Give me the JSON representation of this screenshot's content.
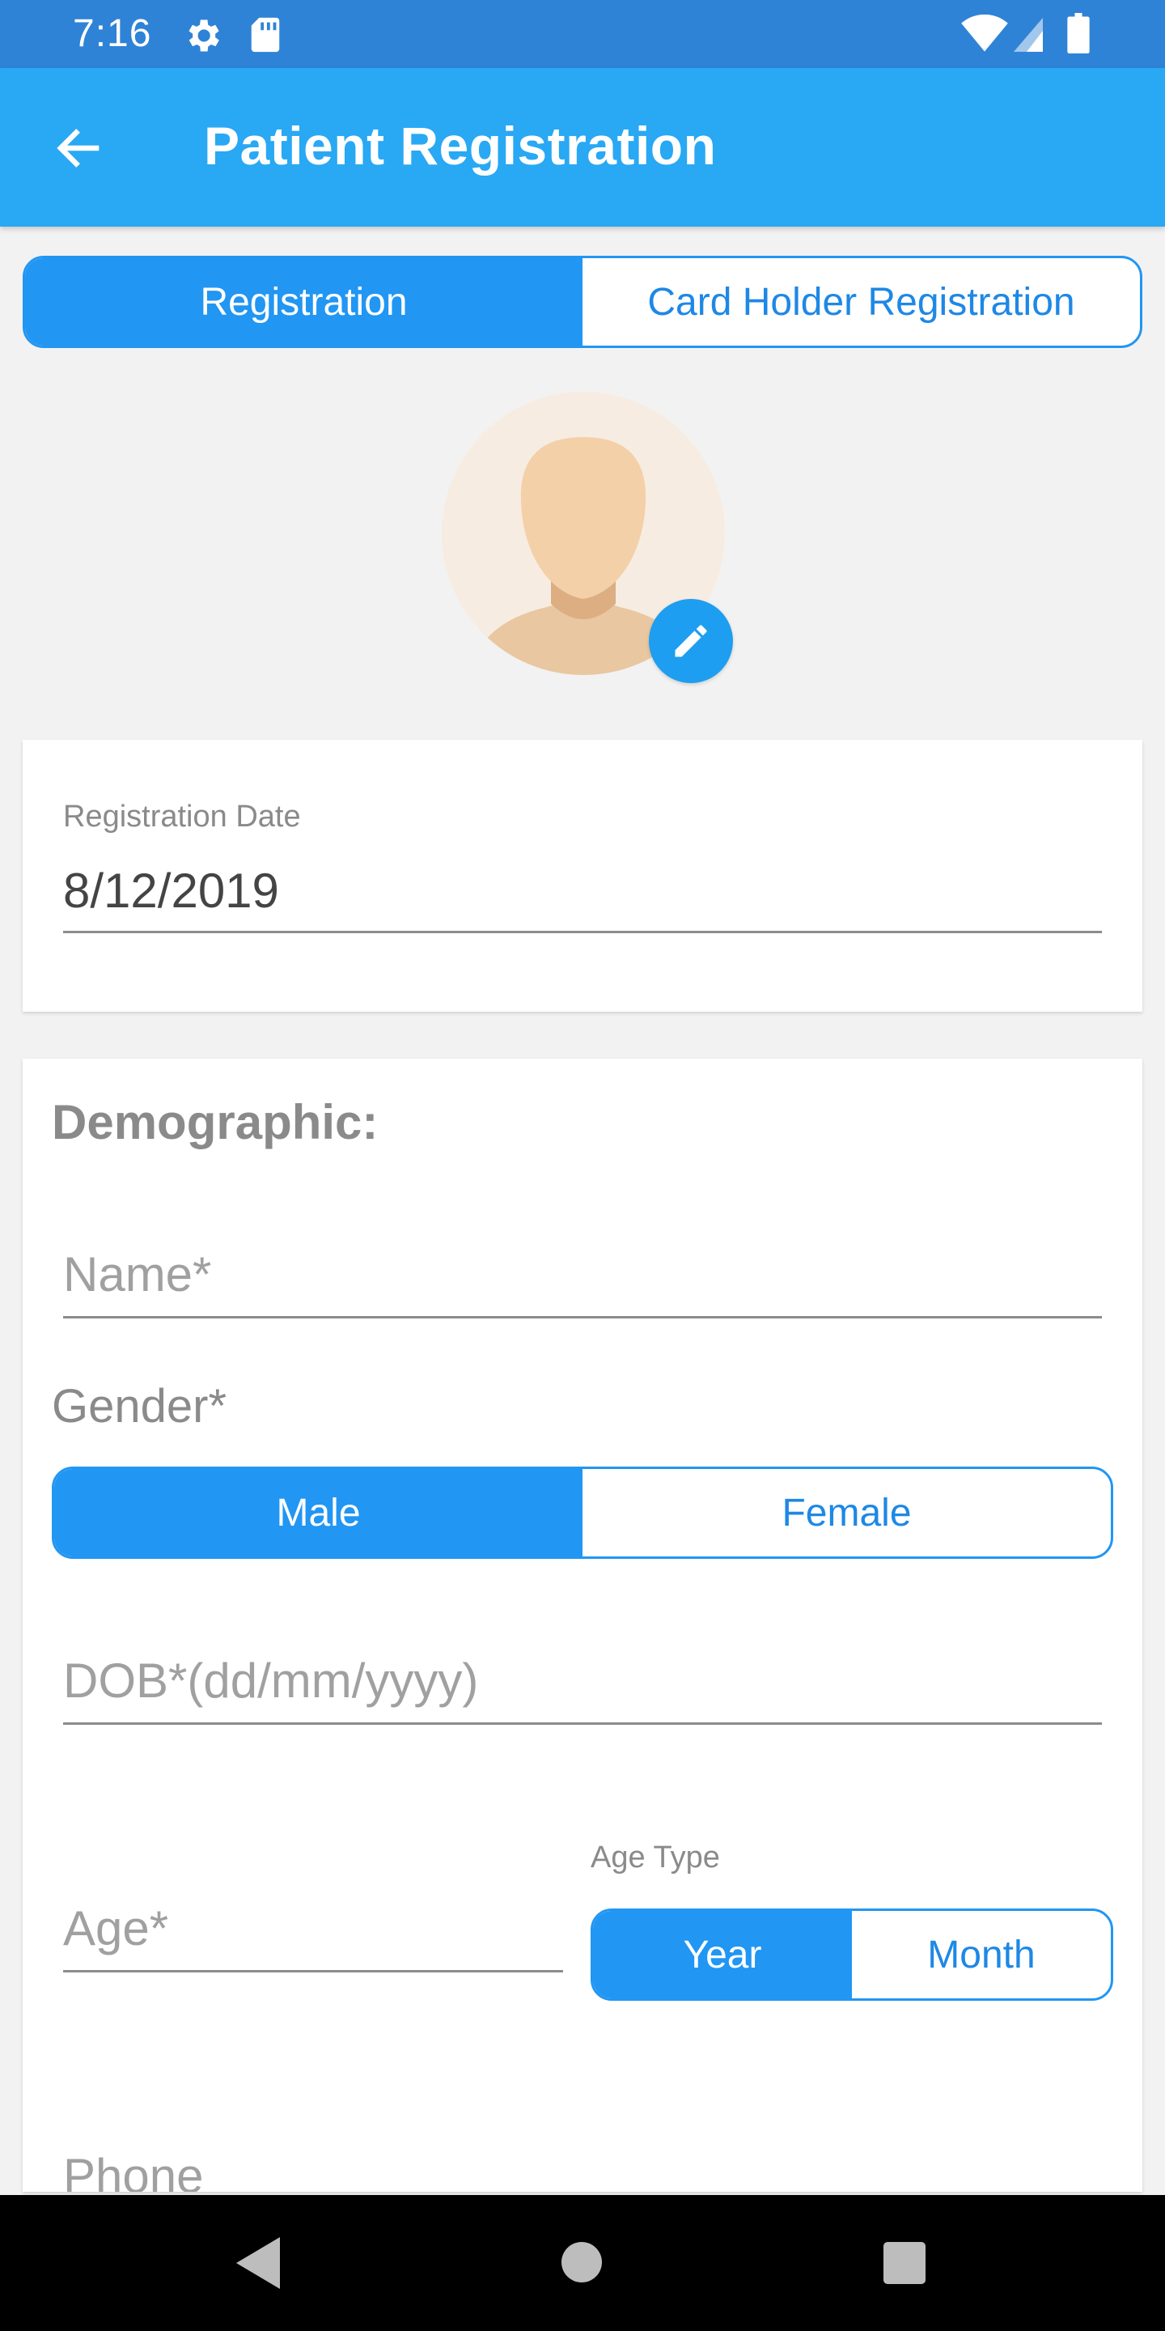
{
  "status_bar": {
    "time": "7:16",
    "icons": [
      "gear-icon",
      "sd-card-icon",
      "wifi-icon",
      "cell-signal-icon",
      "battery-icon"
    ]
  },
  "app_bar": {
    "title": "Patient Registration",
    "back_icon": "arrow-left-icon"
  },
  "registration_tabs": {
    "items": [
      {
        "label": "Registration",
        "active": true
      },
      {
        "label": "Card Holder Registration",
        "active": false
      }
    ]
  },
  "avatar": {
    "edit_icon": "pencil-icon"
  },
  "registration_date": {
    "label": "Registration Date",
    "value": "8/12/2019"
  },
  "demographic": {
    "title": "Demographic:",
    "name_placeholder": "Name*",
    "gender_label": "Gender*",
    "gender_options": [
      {
        "label": "Male",
        "active": true
      },
      {
        "label": "Female",
        "active": false
      }
    ],
    "dob_placeholder": "DOB*(dd/mm/yyyy)",
    "age_placeholder": "Age*",
    "age_type_label": "Age Type",
    "age_type_options": [
      {
        "label": "Year",
        "active": true
      },
      {
        "label": "Month",
        "active": false
      }
    ],
    "phone_placeholder": "Phone"
  },
  "colors": {
    "status_bar": "#2f83d6",
    "app_bar": "#29a8f4",
    "accent": "#2196f3"
  }
}
